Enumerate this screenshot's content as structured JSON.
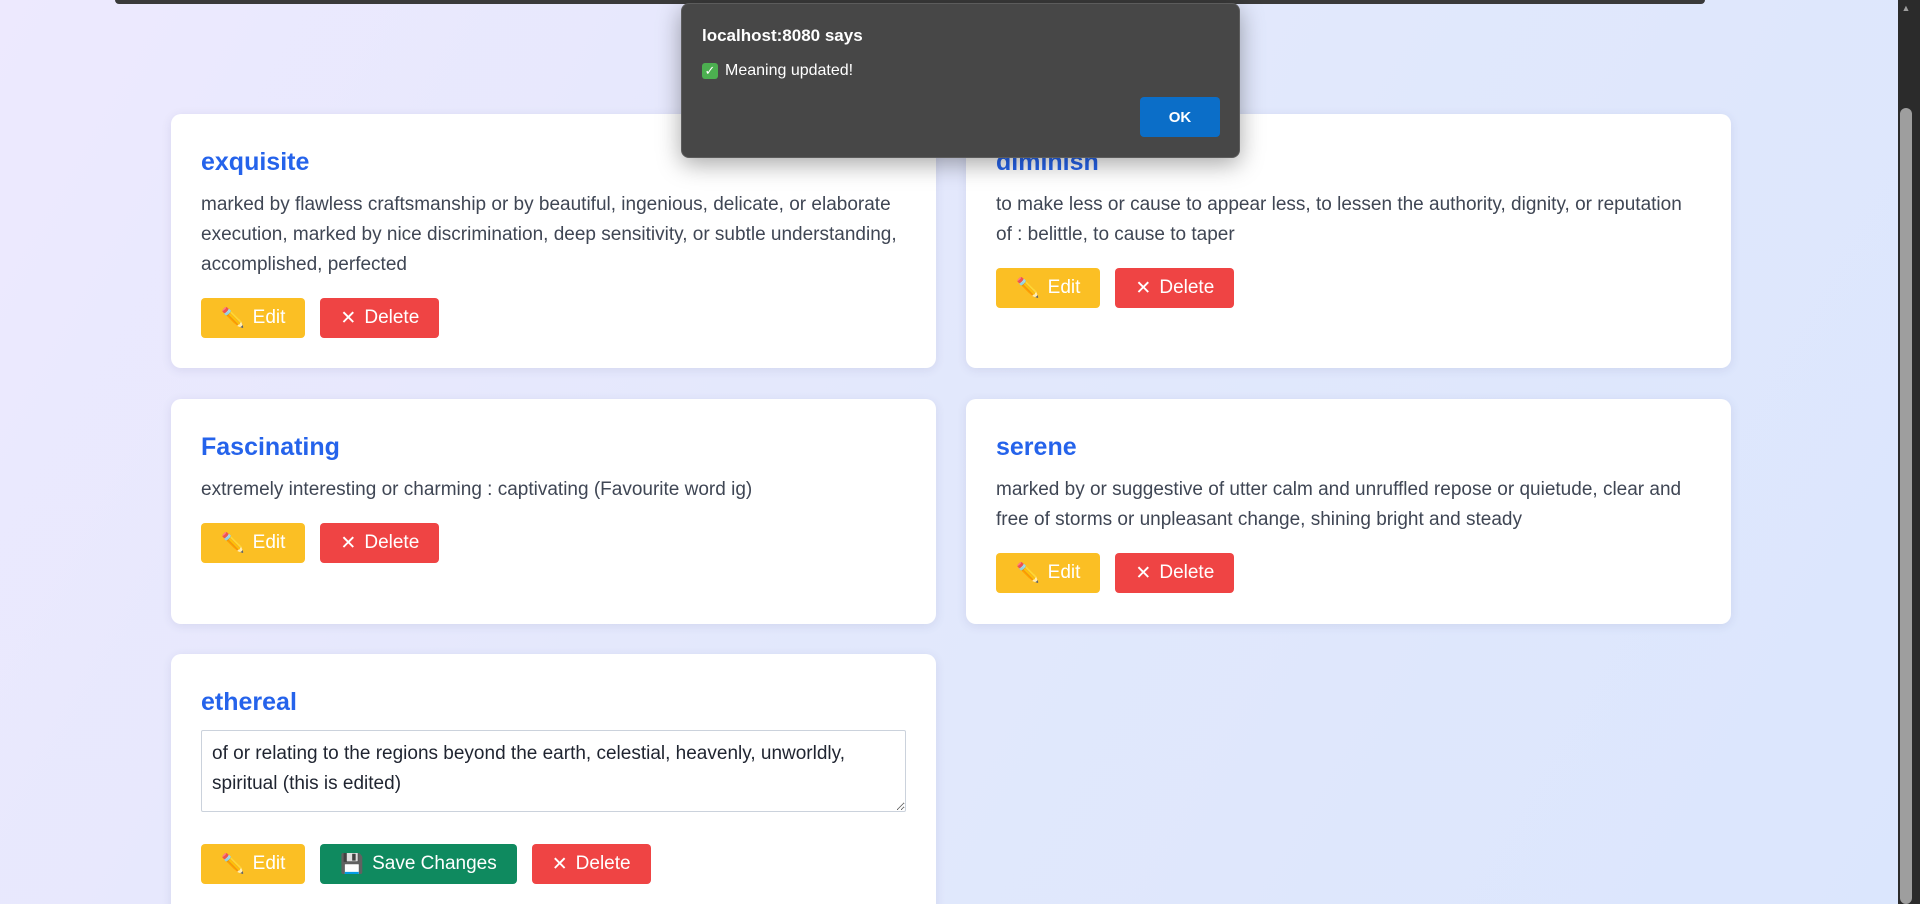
{
  "dialog": {
    "title": "localhost:8080 says",
    "message": "Meaning updated!",
    "ok_label": "OK"
  },
  "buttons": {
    "edit_label": "Edit",
    "delete_label": "Delete",
    "save_label": "Save Changes"
  },
  "cards": [
    {
      "word": "exquisite",
      "meaning": "marked by flawless craftsmanship or by beautiful, ingenious, delicate, or elaborate execution, marked by nice discrimination, deep sensitivity, or subtle understanding, accomplished, perfected"
    },
    {
      "word": "diminish",
      "meaning": "to make less or cause to appear less, to lessen the authority, dignity, or reputation of : belittle, to cause to taper"
    },
    {
      "word": "Fascinating",
      "meaning": "extremely interesting or charming : captivating (Favourite word ig)"
    },
    {
      "word": "serene",
      "meaning": "marked by or suggestive of utter calm and unruffled repose or quietude, clear and free of storms or unpleasant change, shining bright and steady"
    },
    {
      "word": "ethereal",
      "edit_value": "of or relating to the regions beyond the earth, celestial, heavenly, unworldly, spiritual (this is edited)"
    }
  ],
  "icons": {
    "edit": "pencil-icon",
    "delete": "cross-icon",
    "save": "floppy-disk-icon",
    "check": "checkmark-icon"
  },
  "colors": {
    "word": "#2563eb",
    "edit": "#fbbf24",
    "delete": "#ef4444",
    "save": "#0f8a5f",
    "dialog_ok": "#0b6ec8"
  }
}
